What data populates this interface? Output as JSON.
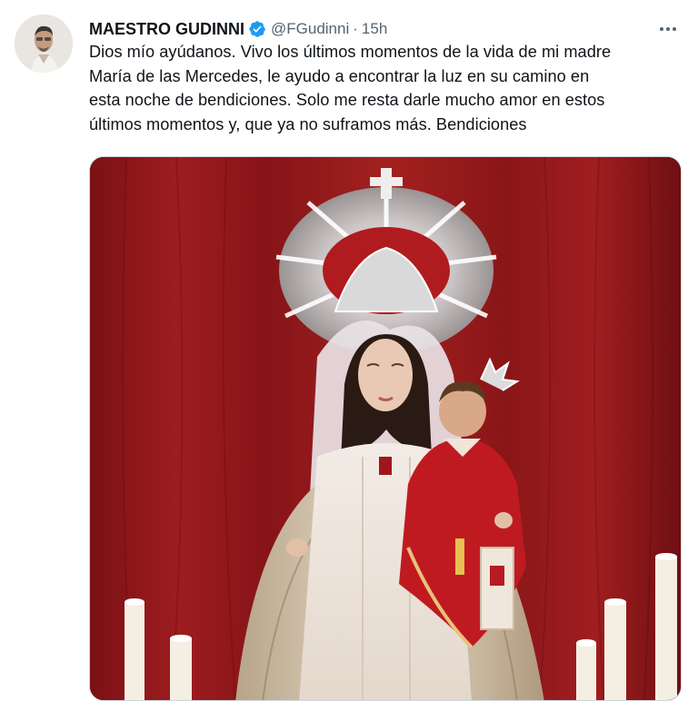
{
  "author": {
    "name": "MAESTRO GUDINNI",
    "handle": "@FGudinni",
    "separator": "·",
    "time": "15h"
  },
  "tweet": {
    "lines": [
      "Dios mío ayúdanos. Vivo los últimos momentos de la vida de mi madre",
      "María de las Mercedes, le ayudo a encontrar la luz en su camino en",
      "esta noche de bendiciones. Solo me resta darle mucho amor en estos",
      "últimos momentos y, que ya no suframos más. Bendiciones"
    ]
  },
  "icons": {
    "verified": "verified-badge-icon",
    "more": "more-options-icon"
  },
  "colors": {
    "verified_blue": "#1d9bf0",
    "text_primary": "#0f1419",
    "text_secondary": "#536471",
    "background": "#ffffff",
    "media_border": "#cfd9de"
  }
}
